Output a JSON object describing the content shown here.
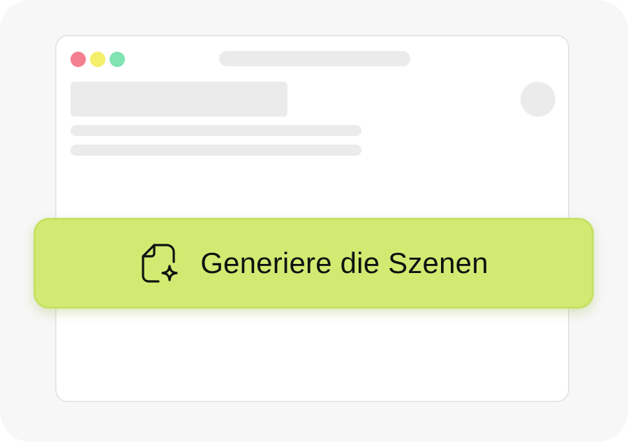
{
  "colors": {
    "background": "#f7f7f7",
    "window_border": "#e6e6e6",
    "skeleton": "#ebebeb",
    "traffic_red": "#f47f8f",
    "traffic_yellow": "#f3ef6a",
    "traffic_green": "#7fe3b2",
    "button_fill": "#d3ea72",
    "button_border": "#c6e164",
    "button_text": "#111111"
  },
  "window": {
    "controls": [
      "close-dot",
      "minimize-dot",
      "zoom-dot"
    ]
  },
  "generate_button": {
    "label": "Generiere die Szenen",
    "icon": "sparkle-document-icon"
  }
}
